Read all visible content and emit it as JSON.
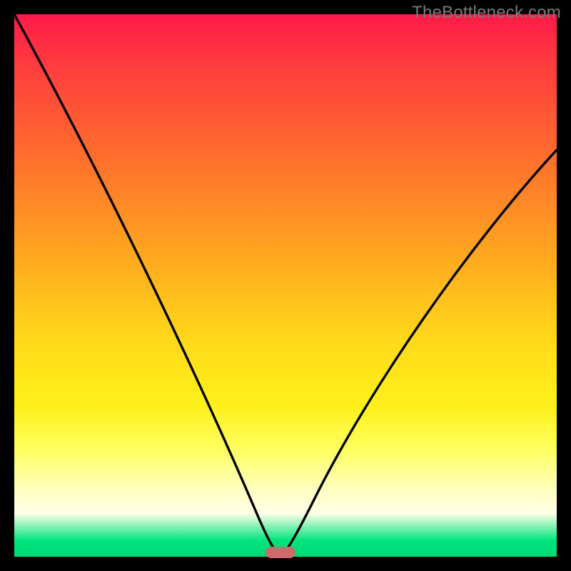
{
  "watermark": "TheBottleneck.com",
  "chart_data": {
    "type": "line",
    "title": "",
    "xlabel": "",
    "ylabel": "",
    "xlim": [
      0,
      100
    ],
    "ylim": [
      0,
      100
    ],
    "series": [
      {
        "name": "curve",
        "x": [
          0,
          5,
          10,
          15,
          20,
          25,
          30,
          35,
          40,
          45,
          47.5,
          50,
          55,
          60,
          65,
          70,
          75,
          80,
          85,
          90,
          95,
          100
        ],
        "values": [
          100,
          89,
          78,
          68,
          58,
          49,
          40,
          31,
          22,
          12,
          6,
          0,
          7,
          15,
          23,
          32,
          41,
          50,
          59,
          66,
          72,
          75
        ]
      }
    ],
    "marker": {
      "x_percent": 49,
      "y_percent": 0
    },
    "gradient_stops": [
      {
        "pos": 0,
        "color": "#ff1a49"
      },
      {
        "pos": 10,
        "color": "#ff3e3e"
      },
      {
        "pos": 25,
        "color": "#ff6a2e"
      },
      {
        "pos": 45,
        "color": "#ffa91f"
      },
      {
        "pos": 60,
        "color": "#ffd91a"
      },
      {
        "pos": 72,
        "color": "#fff01a"
      },
      {
        "pos": 80,
        "color": "#ffff5e"
      },
      {
        "pos": 88,
        "color": "#ffffc4"
      },
      {
        "pos": 92,
        "color": "#ffffe8"
      },
      {
        "pos": 97,
        "color": "#00e47c"
      },
      {
        "pos": 100,
        "color": "#00d874"
      }
    ]
  }
}
